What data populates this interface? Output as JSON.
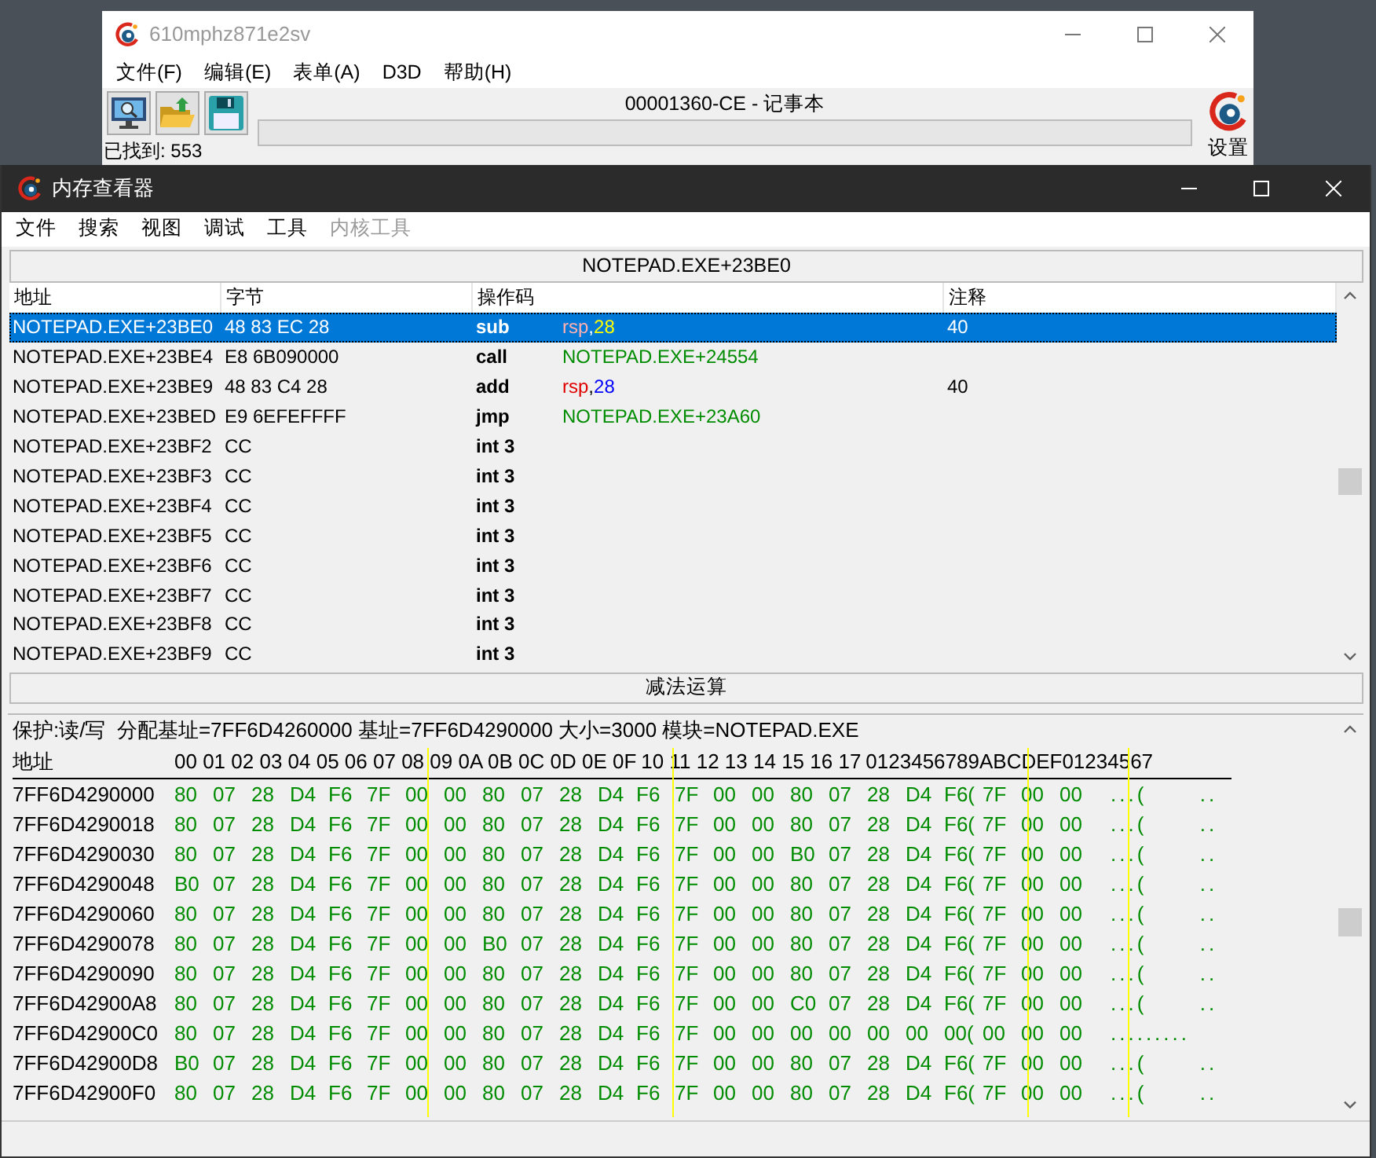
{
  "back_window": {
    "title": "610mphz871e2sv",
    "menu": [
      {
        "label": "文件(F)"
      },
      {
        "label": "编辑(E)"
      },
      {
        "label": "表单(A)"
      },
      {
        "label": "D3D"
      },
      {
        "label": "帮助(H)"
      }
    ],
    "process": "00001360-CE - 记事本",
    "progress": {
      "level": 0
    },
    "settings_label": "设置",
    "found": "已找到: 553"
  },
  "memory_viewer": {
    "title": "内存查看器",
    "menu": [
      {
        "label": "文件",
        "disabled": false
      },
      {
        "label": "搜索",
        "disabled": false
      },
      {
        "label": "视图",
        "disabled": false
      },
      {
        "label": "调试",
        "disabled": false
      },
      {
        "label": "工具",
        "disabled": false
      },
      {
        "label": "内核工具",
        "disabled": true
      }
    ],
    "address_bar": "NOTEPAD.EXE+23BE0",
    "columns": [
      "地址",
      "字节",
      "操作码",
      "注释"
    ],
    "rows": [
      {
        "address": "NOTEPAD.EXE+23BE0",
        "bytes": "48 83 EC 28",
        "opcode": "sub",
        "operand": [
          {
            "text": "rsp",
            "kind": "register"
          },
          {
            "text": ",",
            "kind": "plain"
          },
          {
            "text": "28",
            "kind": "number"
          }
        ],
        "comment": "40",
        "selected": true
      },
      {
        "address": "NOTEPAD.EXE+23BE4",
        "bytes": "E8 6B090000",
        "opcode": "call",
        "operand": [
          {
            "text": "NOTEPAD.EXE+24554",
            "kind": "address"
          }
        ],
        "selected": false
      },
      {
        "address": "NOTEPAD.EXE+23BE9",
        "bytes": "48 83 C4 28",
        "opcode": "add",
        "operand": [
          {
            "text": "rsp",
            "kind": "register"
          },
          {
            "text": ",",
            "kind": "plain"
          },
          {
            "text": "28",
            "kind": "number"
          }
        ],
        "comment": "40",
        "selected": false
      },
      {
        "address": "NOTEPAD.EXE+23BED",
        "bytes": "E9 6EFEFFFF",
        "opcode": "jmp",
        "operand": [
          {
            "text": "NOTEPAD.EXE+23A60",
            "kind": "address"
          }
        ],
        "selected": false
      },
      {
        "address": "NOTEPAD.EXE+23BF2",
        "bytes": "CC",
        "opcode": "int 3",
        "selected": false
      },
      {
        "address": "NOTEPAD.EXE+23BF3",
        "bytes": "CC",
        "opcode": "int 3",
        "selected": false
      },
      {
        "address": "NOTEPAD.EXE+23BF4",
        "bytes": "CC",
        "opcode": "int 3",
        "selected": false
      },
      {
        "address": "NOTEPAD.EXE+23BF5",
        "bytes": "CC",
        "opcode": "int 3",
        "selected": false
      },
      {
        "address": "NOTEPAD.EXE+23BF6",
        "bytes": "CC",
        "opcode": "int 3",
        "selected": false
      },
      {
        "address": "NOTEPAD.EXE+23BF7",
        "bytes": "CC",
        "opcode": "int 3",
        "selected": false
      },
      {
        "address": "NOTEPAD.EXE+23BF8",
        "bytes": "CC",
        "opcode": "int 3",
        "selected": false
      },
      {
        "address": "NOTEPAD.EXE+23BF9",
        "bytes": "CC",
        "opcode": "int 3",
        "selected": false
      }
    ],
    "status": "减法运算",
    "hex_info": "保护:读/写  分配基址=7FF6D4260000 基址=7FF6D4290000 大小=3000 模块=NOTEPAD.EXE",
    "hex_header": {
      "label": "地址",
      "offsets_a": "00 01 02 03 04 05 06 07 08 09 0A 0B 0C 0D 0E 0F",
      "offsets_b": "10 11 12 13 14 15 16 17",
      "ascii": "0123456789ABCDEF01234567"
    },
    "hex_rows": [
      {
        "address": "7FF6D4290000",
        "bytes": "80 07 28 D4 F6 7F 00 00 80 07 28 D4 F6 7F 00 00 80 07 28 D4 F6( 7F 00 00",
        "ascii": "...(      .."
      },
      {
        "address": "7FF6D4290018",
        "bytes": "80 07 28 D4 F6 7F 00 00 80 07 28 D4 F6 7F 00 00 80 07 28 D4 F6( 7F 00 00",
        "ascii": "...(      .."
      },
      {
        "address": "7FF6D4290030",
        "bytes": "80 07 28 D4 F6 7F 00 00 80 07 28 D4 F6 7F 00 00 B0 07 28 D4 F6( 7F 00 00",
        "ascii": "...(      .."
      },
      {
        "address": "7FF6D4290048",
        "bytes": "B0 07 28 D4 F6 7F 00 00 80 07 28 D4 F6 7F 00 00 80 07 28 D4 F6( 7F 00 00",
        "ascii": "...(      .."
      },
      {
        "address": "7FF6D4290060",
        "bytes": "80 07 28 D4 F6 7F 00 00 80 07 28 D4 F6 7F 00 00 80 07 28 D4 F6( 7F 00 00",
        "ascii": "...(      .."
      },
      {
        "address": "7FF6D4290078",
        "bytes": "80 07 28 D4 F6 7F 00 00 B0 07 28 D4 F6 7F 00 00 80 07 28 D4 F6( 7F 00 00",
        "ascii": "...(      .."
      },
      {
        "address": "7FF6D4290090",
        "bytes": "80 07 28 D4 F6 7F 00 00 80 07 28 D4 F6 7F 00 00 80 07 28 D4 F6( 7F 00 00",
        "ascii": "...(      .."
      },
      {
        "address": "7FF6D42900A8",
        "bytes": "80 07 28 D4 F6 7F 00 00 80 07 28 D4 F6 7F 00 00 C0 07 28 D4 F6( 7F 00 00",
        "ascii": "...(      .."
      },
      {
        "address": "7FF6D42900C0",
        "bytes": "80 07 28 D4 F6 7F 00 00 80 07 28 D4 F6 7F 00 00 00 00 00 00 00( 00 00 00",
        "ascii": "........."
      },
      {
        "address": "7FF6D42900D8",
        "bytes": "B0 07 28 D4 F6 7F 00 00 80 07 28 D4 F6 7F 00 00 80 07 28 D4 F6( 7F 00 00",
        "ascii": "...(      .."
      },
      {
        "address": "7FF6D42900F0",
        "bytes": "80 07 28 D4 F6 7F 00 00 80 07 28 D4 F6 7F 00 00 80 07 28 D4 F6( 7F 00 00",
        "ascii": "...(      .."
      }
    ]
  }
}
